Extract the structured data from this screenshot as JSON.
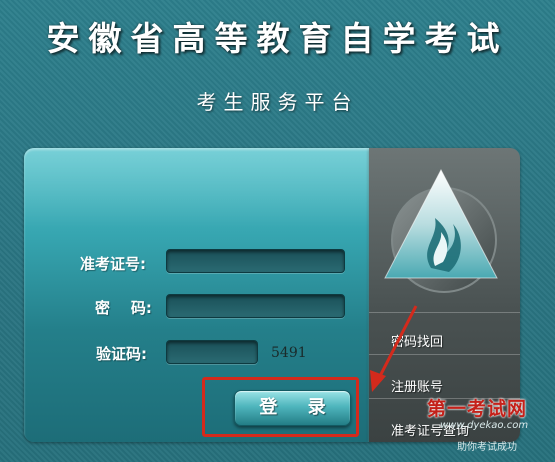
{
  "header": {
    "title": "安徽省高等教育自学考试",
    "subtitle": "考生服务平台"
  },
  "login_form": {
    "exam_id_label": "准考证号:",
    "exam_id_value": "",
    "password_label": "密    码:",
    "password_value": "",
    "captcha_label": "验证码:",
    "captcha_value": "",
    "captcha_code": "5491",
    "login_button": "登 录"
  },
  "sidebar": {
    "logo": "triangle-flame-logo-icon",
    "links": [
      {
        "label": "密码找回"
      },
      {
        "label": "注册账号"
      },
      {
        "label": "准考证号查询"
      }
    ]
  },
  "annotations": {
    "highlight_color": "#d42a1c",
    "arrow_color": "#d42a1c"
  },
  "watermark": {
    "title": "第一考试网",
    "url": "www.dyekao.com",
    "slogan": "助你考试成功"
  },
  "colors": {
    "background": "#2a7582",
    "panel_top": "#52c3cc",
    "panel_bottom": "#1d6d78",
    "sidebar": "#4a5252"
  }
}
